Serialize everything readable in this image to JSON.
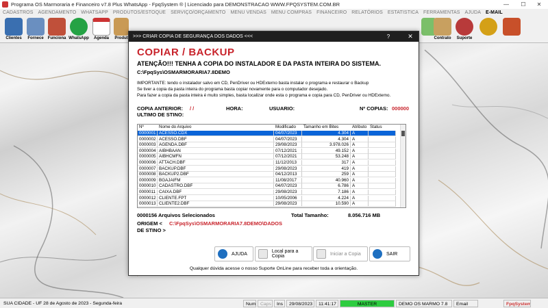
{
  "window": {
    "title": "Programa OS Marmoraria e Financeiro v7.8 Plus WhatsApp - FpqSystem ® | Licenciado para  DEMONSTRACAO WWW.FPQSYSTEM.COM.BR",
    "min": "—",
    "max": "☐",
    "close": "✕"
  },
  "menu": [
    "CADASTROS",
    "AGENDAMENTO",
    "WHATSAPP",
    "PRODUTOS/ESTOQUE",
    "SERVIÇO/ORÇAMENTO",
    "MENU VENDAS",
    "MENU COMPRAS",
    "FINANCEIRO",
    "RELATÓRIOS",
    "ESTATISTICA",
    "FERRAMENTAS",
    "AJUDA",
    "E-MAIL"
  ],
  "toolbar": [
    {
      "label": "Clientes",
      "color": "#3a6fb0"
    },
    {
      "label": "Fornece",
      "color": "#6a8fc0"
    },
    {
      "label": "Funciona",
      "color": "#c0503a"
    },
    {
      "label": "WhatsApp",
      "color": "#25a244"
    },
    {
      "label": "Agenda",
      "color": "#d9d9d9"
    },
    {
      "label": "Produt",
      "color": "#c99a55"
    },
    {
      "label": "Contrato",
      "color": "#c8a060"
    },
    {
      "label": "Suporte",
      "color": "#b83a3a"
    }
  ],
  "dialog": {
    "title": ">>> CRIAR COPIA DE SEGURANÇA DOS DADOS <<<",
    "help": "?",
    "close": "✕",
    "heading": "COPIAR / BACKUP",
    "warning": "ATENÇÃO!!!  TENHA A COPIA DO  INSTALADOR  E  DA PASTA INTEIRA DO  SISTEMA.",
    "path": "C:\\FpqSys\\OSMARMORARIA7.8DEMO",
    "info": [
      "IMPORTANTE: tendo o instalador salvo em CD, PenDriver ou HDExterno basta instalar o programa e restaurar o Backup",
      "Se tiver a copia da pasta inteira do programa basta copiar novamente para o computador desejado.",
      "Para fazer a copia da pasta inteira é muito simples, basta localizar onde esta o programa e copia para CD, PenDriver ou HDExterno."
    ],
    "copia_anterior_label": "COPIA ANTERIOR:",
    "copia_anterior_value": "/  /",
    "hora_label": "HORA:",
    "usuario_label": "USUARIO:",
    "ncopias_label": "Nº COPIAS:",
    "ncopias_value": "000000",
    "ultimo_destino_label": "ULTIMO DE STINO:",
    "columns": [
      "Nº",
      "Nome do Arquivo",
      "Modificado",
      "Tamanho em Bites",
      "Atributo",
      "Status"
    ],
    "rows": [
      [
        "0000001",
        "ACESSO.CDX",
        "04/07/2023",
        "4.304",
        "A",
        ""
      ],
      [
        "0000002",
        "ACESSO.DBF",
        "04/07/2023",
        "4.304",
        "A",
        ""
      ],
      [
        "0000003",
        "AGENDA.DBF",
        "29/08/2023",
        "3.978.026",
        "A",
        ""
      ],
      [
        "0000004",
        "AIBHBAAN",
        "07/12/2021",
        "49.152",
        "A",
        ""
      ],
      [
        "0000005",
        "AIBHCMFN",
        "07/12/2021",
        "53.248",
        "A",
        ""
      ],
      [
        "0000006",
        "ATTACH.DBF",
        "11/12/2013",
        "317",
        "A",
        ""
      ],
      [
        "0000007",
        "BACKUP.DBF",
        "29/08/2023",
        "419",
        "A",
        ""
      ],
      [
        "0000008",
        "BACKUP2.DBF",
        "04/12/2013",
        "259",
        "A",
        ""
      ],
      [
        "0000009",
        "BGAJAIFM",
        "11/08/2017",
        "40.960",
        "A",
        ""
      ],
      [
        "0000010",
        "CADASTRO.DBF",
        "04/07/2023",
        "6.786",
        "A",
        ""
      ],
      [
        "0000011",
        "CAIXA.DBF",
        "29/08/2023",
        "7.186",
        "A",
        ""
      ],
      [
        "0000012",
        "CLIENTE.FPT",
        "10/05/2006",
        "4.224",
        "A",
        ""
      ],
      [
        "0000013",
        "CLIENTE2.DBF",
        "29/08/2023",
        "10.590",
        "A",
        ""
      ]
    ],
    "arquivos_selecionados": "0000156 Arquivos  Selecionados",
    "total_label": "Total Tamanho:",
    "total_value": "8.056.716 MB",
    "origem_label": "ORIGEM  <",
    "origem_value": "C:\\FpqSys\\OSMARMORARIA7.8DEMO\\DADOS",
    "destino_label": "DE STINO >",
    "buttons": [
      {
        "label": "AJUDA",
        "icon": "info-icon",
        "color": "#1e6fc0",
        "disabled": false
      },
      {
        "label": "Local para a Copia",
        "icon": "folder-icon",
        "color": "#e8e8e8",
        "disabled": false
      },
      {
        "label": "Iniciar a Copia",
        "icon": "check-icon",
        "color": "#e8e8e8",
        "disabled": true
      },
      {
        "label": "SAIR",
        "icon": "exit-icon",
        "color": "#1e6fc0",
        "disabled": false
      }
    ],
    "support_text": "Qualquer dúvida acesse o nosso Suporte OnLine para receber toda a orientação."
  },
  "statusbar": {
    "city": "SUA CIDADE - UF 28 de Agosto de 2023 - Segunda-feira",
    "num": "Num",
    "caps": "Caps",
    "ins": "Ins",
    "date": "29/08/2023",
    "time": "11:41:17",
    "master": "MASTER",
    "demo": "DEMO OS MARMO 7.8",
    "email": "Email",
    "brand": "FpqSystem",
    "master_color": "#2ecc40"
  }
}
